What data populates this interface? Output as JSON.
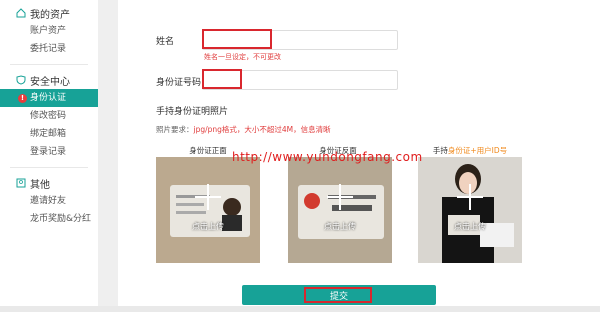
{
  "sidebar": {
    "section_assets": "我的资产",
    "assets_items": [
      "账户资产",
      "委托记录"
    ],
    "section_security": "安全中心",
    "security_items": [
      "身份认证",
      "修改密码",
      "绑定邮箱",
      "登录记录"
    ],
    "section_other": "其他",
    "other_items": [
      "邀请好友",
      "龙币奖励&分红"
    ]
  },
  "form": {
    "name_label": "姓名",
    "name_hint": "姓名一旦设定，不可更改",
    "id_label": "身份证号码",
    "photo_section_title": "手持身份证明照片",
    "requirement_prefix": "照片要求：",
    "requirement_text": "jpg/png格式，大小不超过4M，信息清晰",
    "front_caption": "身份证正面",
    "back_caption": "身份证反面",
    "hold_caption_prefix": "手持",
    "hold_caption_highlight": "身份证+用户ID号",
    "upload_label": "点击上传",
    "submit_label": "提交"
  },
  "watermark": "http://www.yundongfang.com",
  "colors": {
    "accent": "#17a297",
    "alert_red": "#d9272e",
    "highlight_orange": "#f08a1d"
  }
}
